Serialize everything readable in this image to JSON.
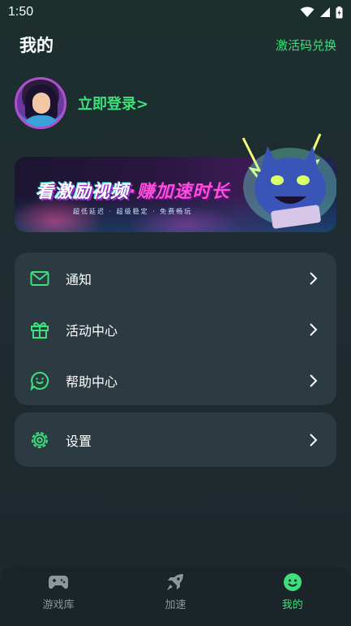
{
  "status_bar": {
    "time": "1:50"
  },
  "header": {
    "title": "我的",
    "redeem_label": "激活码兑换"
  },
  "profile": {
    "login_label": "立即登录>"
  },
  "banner": {
    "title_main": "看激励视频",
    "title_accent": "·赚加速时长",
    "subtitle": "超低延迟 · 超级稳定 · 免费畅玩"
  },
  "menu": {
    "items": [
      {
        "label": "通知",
        "icon": "mail-icon"
      },
      {
        "label": "活动中心",
        "icon": "gift-icon"
      },
      {
        "label": "帮助中心",
        "icon": "chat-bubble-icon"
      }
    ],
    "settings": {
      "label": "设置",
      "icon": "gear-icon"
    }
  },
  "tabbar": {
    "tabs": [
      {
        "label": "游戏库",
        "icon": "gamepad-icon",
        "active": false
      },
      {
        "label": "加速",
        "icon": "rocket-icon",
        "active": false
      },
      {
        "label": "我的",
        "icon": "smile-icon",
        "active": true
      }
    ]
  },
  "colors": {
    "accent": "#3ee07e",
    "card": "#2c3a41",
    "tabbar": "#1b2428",
    "inactive": "#8c979c"
  }
}
